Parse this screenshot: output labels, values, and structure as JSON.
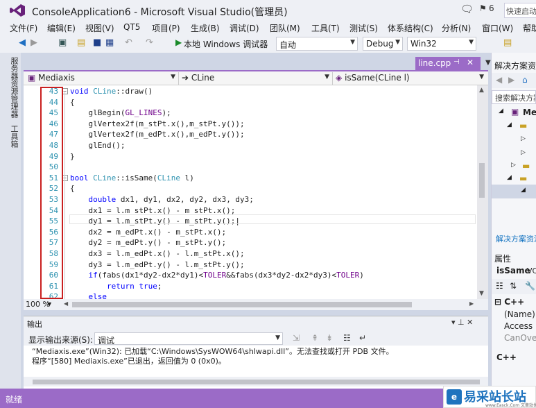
{
  "window": {
    "title": "ConsoleApplication6 - Microsoft Visual Studio(管理员)",
    "flag_count": "6",
    "quick_launch_placeholder": "快速启动"
  },
  "menu": [
    "文件(F)",
    "编辑(E)",
    "视图(V)",
    "QT5",
    "项目(P)",
    "生成(B)",
    "调试(D)",
    "团队(M)",
    "工具(T)",
    "测试(S)",
    "体系结构(C)",
    "分析(N)",
    "窗口(W)",
    "帮助"
  ],
  "toolbar": {
    "run_label": "本地 Windows 调试器",
    "run_mode": "自动",
    "config": "Debug",
    "platform": "Win32"
  },
  "left_strip": {
    "server_explorer": "服务器资源管理器",
    "toolbox": "工具箱"
  },
  "editor": {
    "tab_label": "line.cpp",
    "nav_project": "Mediaxis",
    "nav_class": "CLine",
    "nav_member": "isSame(CLine l)",
    "zoom": "100 %",
    "lines": [
      {
        "n": "43",
        "fold": "−",
        "text": "void CLine::draw()"
      },
      {
        "n": "44",
        "fold": "",
        "text": "{"
      },
      {
        "n": "45",
        "fold": "",
        "text": "    glBegin(GL_LINES);"
      },
      {
        "n": "46",
        "fold": "",
        "text": "    glVertex2f(m_stPt.x(),m_stPt.y());"
      },
      {
        "n": "47",
        "fold": "",
        "text": "    glVertex2f(m_edPt.x(),m_edPt.y());"
      },
      {
        "n": "48",
        "fold": "",
        "text": "    glEnd();"
      },
      {
        "n": "49",
        "fold": "",
        "text": "}"
      },
      {
        "n": "50",
        "fold": "",
        "text": ""
      },
      {
        "n": "51",
        "fold": "−",
        "text": "bool CLine::isSame(CLine l)"
      },
      {
        "n": "52",
        "fold": "",
        "text": "{"
      },
      {
        "n": "53",
        "fold": "",
        "text": "    double dx1, dy1, dx2, dy2, dx3, dy3;"
      },
      {
        "n": "54",
        "fold": "",
        "text": "    dx1 = l.m_stPt.x() - m_stPt.x();"
      },
      {
        "n": "55",
        "fold": "",
        "text": "    dy1 = l.m_stPt.y() - m_stPt.y();|"
      },
      {
        "n": "56",
        "fold": "",
        "text": "    dx2 = m_edPt.x() - m_stPt.x();"
      },
      {
        "n": "57",
        "fold": "",
        "text": "    dy2 = m_edPt.y() - m_stPt.y();"
      },
      {
        "n": "58",
        "fold": "",
        "text": "    dx3 = l.m_edPt.x() - l.m_stPt.x();"
      },
      {
        "n": "59",
        "fold": "",
        "text": "    dy3 = l.m_edPt.y() - l.m_stPt.y();"
      },
      {
        "n": "60",
        "fold": "",
        "text": "    if(fabs(dx1*dy2-dx2*dy1)<TOLER&&fabs(dx3*dy2-dx2*dy3)<TOLER)"
      },
      {
        "n": "61",
        "fold": "",
        "text": "        return true;"
      },
      {
        "n": "62",
        "fold": "",
        "text": "    else"
      }
    ]
  },
  "output": {
    "title": "输出",
    "source_label": "显示输出来源(S):",
    "source_value": "调试",
    "lines": [
      "“Mediaxis.exe”(Win32): 已加载“C:\\Windows\\SysWOW64\\shlwapi.dll”。无法查找或打开 PDB 文件。",
      "程序“[580] Mediaxis.exe”已退出，返回值为 0 (0x0)。"
    ]
  },
  "solution_explorer": {
    "title": "解决方案资源",
    "search_placeholder": "搜索解决方案",
    "root_label": "Me",
    "link_label": "解决方案资源"
  },
  "properties": {
    "title": "属性",
    "object": "isSame",
    "object_type": "VC",
    "category": "C++",
    "rows": [
      "(Name)",
      "Access",
      "CanOver"
    ],
    "desc_title": "C++"
  },
  "status": {
    "text": "就绪"
  },
  "watermark": {
    "text": "易采站长站",
    "url": "www.Easck.Com  文章站长教程"
  },
  "colors": {
    "accent": "#9b6bc7",
    "keyword": "#0000ff",
    "type": "#2b91af",
    "highlight_box": "#c91f1f"
  }
}
